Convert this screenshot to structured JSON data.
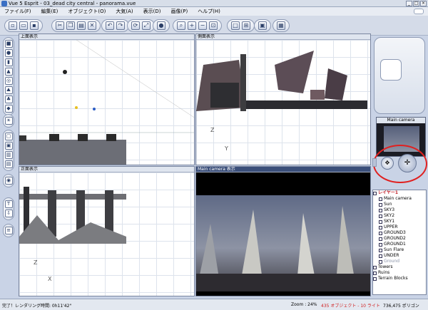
{
  "window": {
    "title": "Vue 5 Esprit - 03_dead city central - panorama.vue"
  },
  "menu": [
    "ファイル(F)",
    "編集(E)",
    "オブジェクト(O)",
    "大気(A)",
    "表示(D)",
    "画像(P)",
    "ヘルプ(H)"
  ],
  "viewports": {
    "top": {
      "title": "上面表示"
    },
    "side": {
      "title": "側面表示"
    },
    "front": {
      "title": "正面表示"
    },
    "camera": {
      "title": "Main camera 表示"
    }
  },
  "axes": {
    "top": [
      "Y",
      "Z"
    ],
    "side_y": "Y",
    "side_z": "Z",
    "front_x": "X",
    "front_z": "Z"
  },
  "camera_panel": {
    "title": "Main camera"
  },
  "layers": {
    "layer1": "レイヤー1",
    "items": [
      "Main camera",
      "Sun",
      "SKY3",
      "SKY2",
      "SKY1",
      "UPPER",
      "GROUND3",
      "GROUND2",
      "GROUND1",
      "Sun Flare",
      "UNDER",
      "Ground"
    ],
    "groups": [
      "Towers",
      "Ruins",
      "Terrain Blocks"
    ]
  },
  "status": {
    "message": "完了！レンダリング時間: 0h11'42\"",
    "zoom": "Zoom : 24%",
    "objects": "435 オブジェクト - 10 ライト",
    "polygons": "736,475 ポリゴン"
  },
  "colors": {
    "highlight_circle": "#e02020",
    "status_objects": "#d02020",
    "selection_red": "#c0202a"
  }
}
